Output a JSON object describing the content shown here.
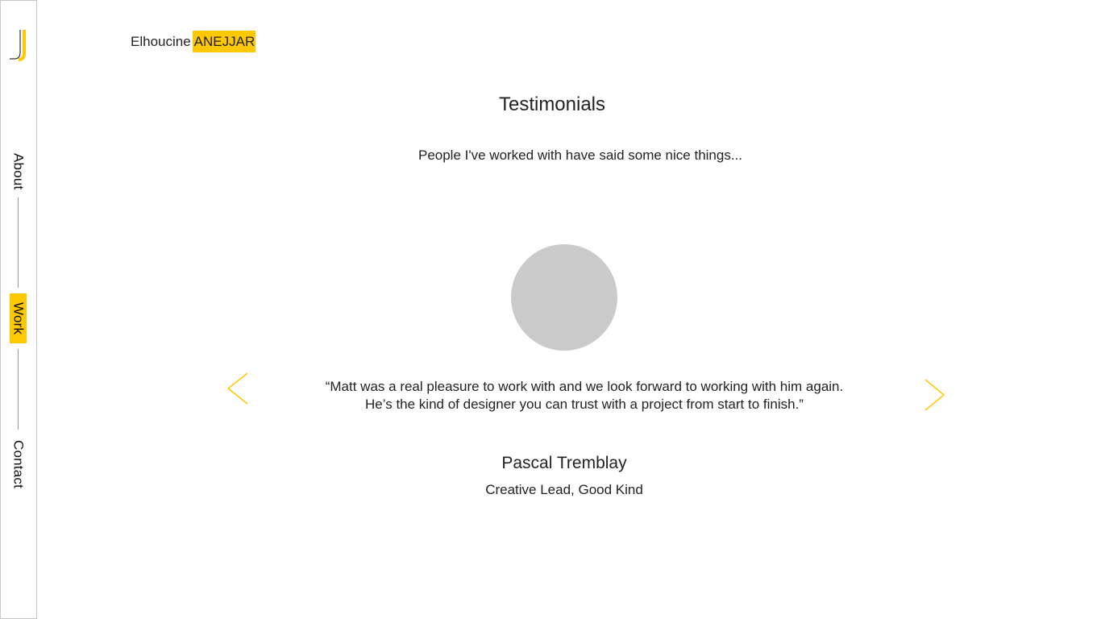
{
  "brand": {
    "first_name": "Elhoucine",
    "last_name": "ANEJJAR",
    "logo_icon": "j-monogram-icon",
    "accent_color": "#ffc800"
  },
  "sidebar": {
    "items": [
      {
        "label": "About",
        "active": false
      },
      {
        "label": "Work",
        "active": true
      },
      {
        "label": "Contact",
        "active": false
      }
    ]
  },
  "section": {
    "title": "Testimonials",
    "subtitle": "People I've worked with have said some nice things..."
  },
  "testimonial": {
    "quote_line1": "“Matt was a real pleasure to work with and we look forward to working with him again.",
    "quote_line2": "He’s the kind of designer you can trust with a project from start to finish.”",
    "name": "Pascal Tremblay",
    "role": "Creative Lead, Good Kind",
    "avatar_color": "#cacaca",
    "prev_icon": "chevron-left-icon",
    "next_icon": "chevron-right-icon"
  }
}
